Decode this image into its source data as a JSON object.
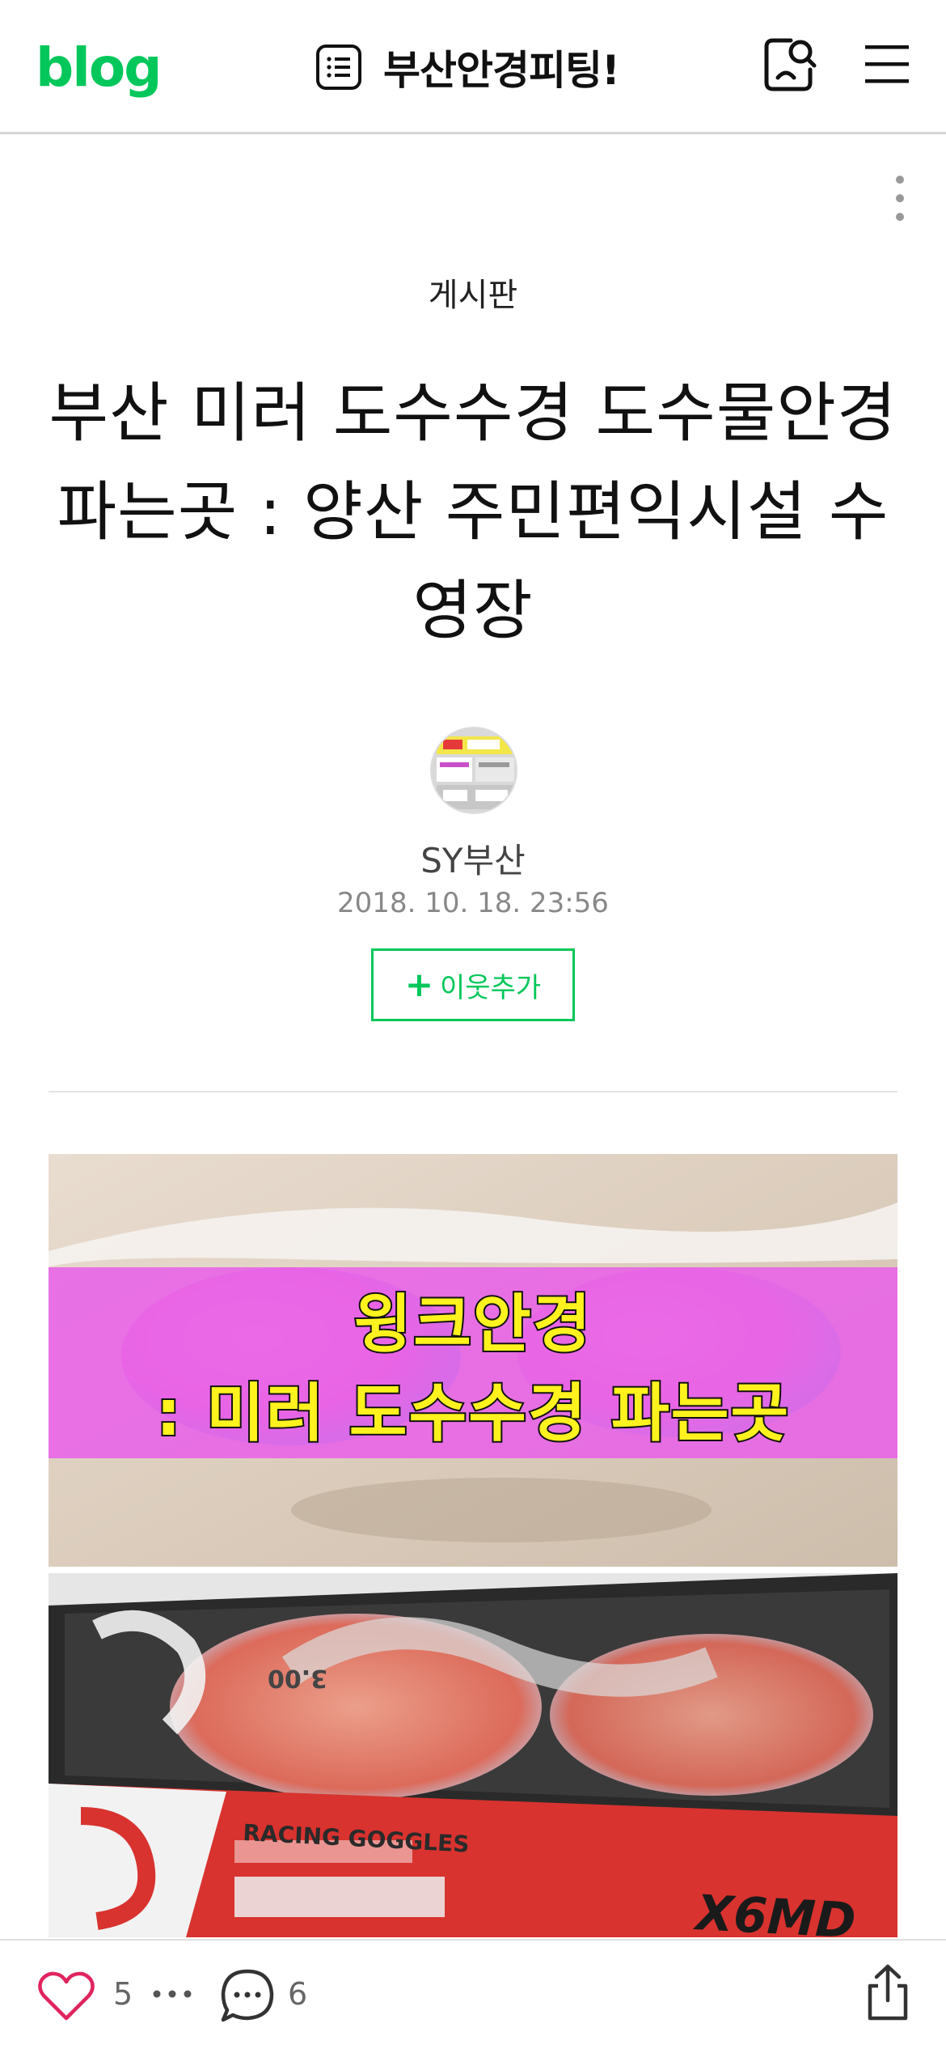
{
  "header": {
    "logo": "blog",
    "blog_title": "부산안경피팅!"
  },
  "post": {
    "category": "게시판",
    "title": "부산 미러 도수수경 도수물안경 파는곳 : 양산 주민편익시설 수영장",
    "author": "SY부산",
    "date": "2018. 10. 18. 23:56",
    "follow_label": "이웃추가",
    "follow_icon": "plus-icon"
  },
  "images": {
    "first_caption_line1": "윙크안경",
    "first_caption_line2": ": 미러 도수수경 파는곳",
    "second_product_text": "RACING GOGGLES",
    "second_model_text": "X6MD",
    "second_badge_text": "3.00"
  },
  "footer": {
    "like_count": "5",
    "comment_count": "6"
  },
  "colors": {
    "brand": "#03c75a",
    "caption_band": "#e862e8",
    "caption_text": "#fff21e",
    "like_heart": "#e0245e"
  }
}
